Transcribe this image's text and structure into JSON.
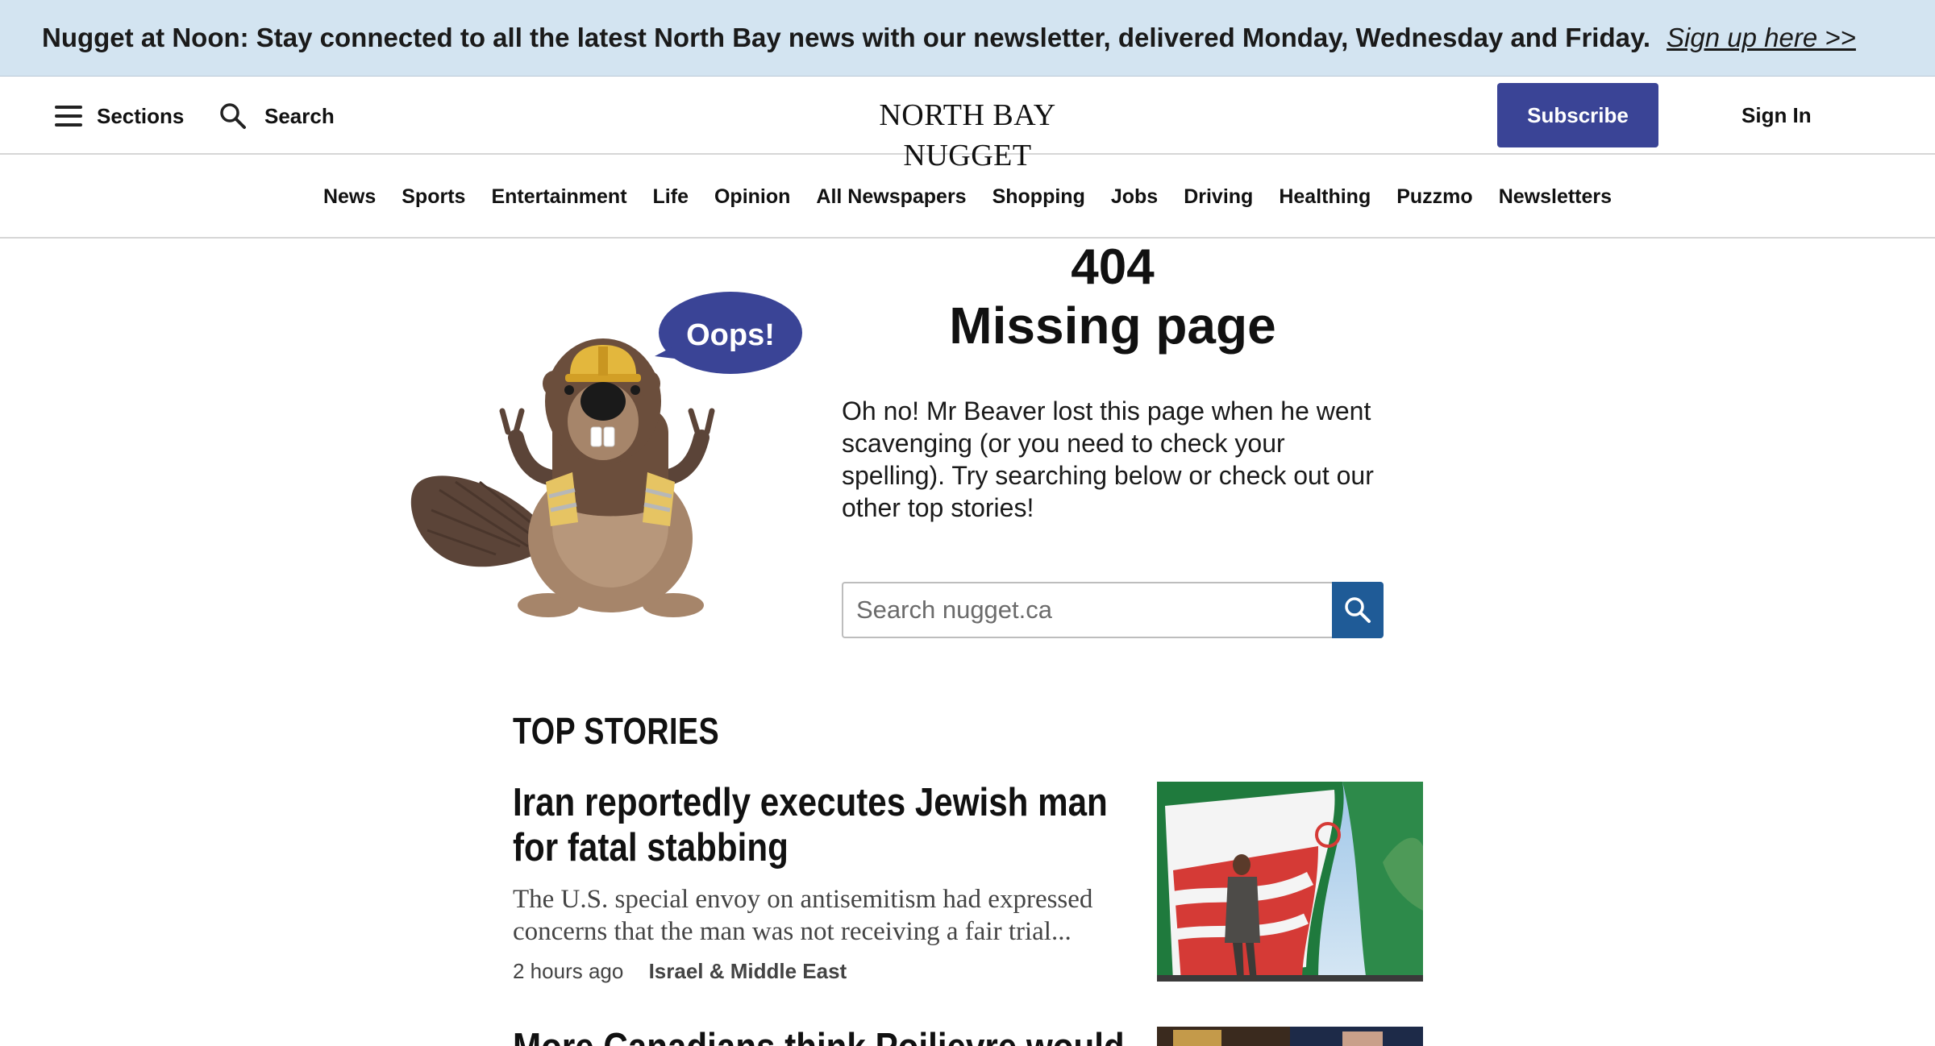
{
  "banner": {
    "text": "Nugget at Noon: Stay connected to all the latest North Bay news with our newsletter, delivered Monday, Wednesday and Friday.",
    "link": "Sign up here >>"
  },
  "header": {
    "sections_label": "Sections",
    "search_label": "Search",
    "logo": "NORTH BAY NUGGET",
    "subscribe_label": "Subscribe",
    "signin_label": "Sign In",
    "accent_color": "#3a4496"
  },
  "nav": {
    "items": [
      "News",
      "Sports",
      "Entertainment",
      "Life",
      "Opinion",
      "All Newspapers",
      "Shopping",
      "Jobs",
      "Driving",
      "Healthing",
      "Puzzmo",
      "Newsletters"
    ]
  },
  "error": {
    "code": "404",
    "title": "Missing page",
    "bubble": "Oops!",
    "description": "Oh no! Mr Beaver lost this page when he went scavenging (or you need to check your spelling). Try searching below or check out our other top stories!",
    "search_placeholder": "Search nugget.ca"
  },
  "top_stories": {
    "heading": "TOP STORIES",
    "stories": [
      {
        "title": "Iran reportedly executes Jewish man for fatal stabbing",
        "summary": "The U.S. special envoy on antisemitism had expressed concerns that the man was not receiving a fair trial...",
        "time": "2 hours ago",
        "category": "Israel & Middle East"
      },
      {
        "title": "More Canadians think Poilievre would"
      }
    ]
  }
}
